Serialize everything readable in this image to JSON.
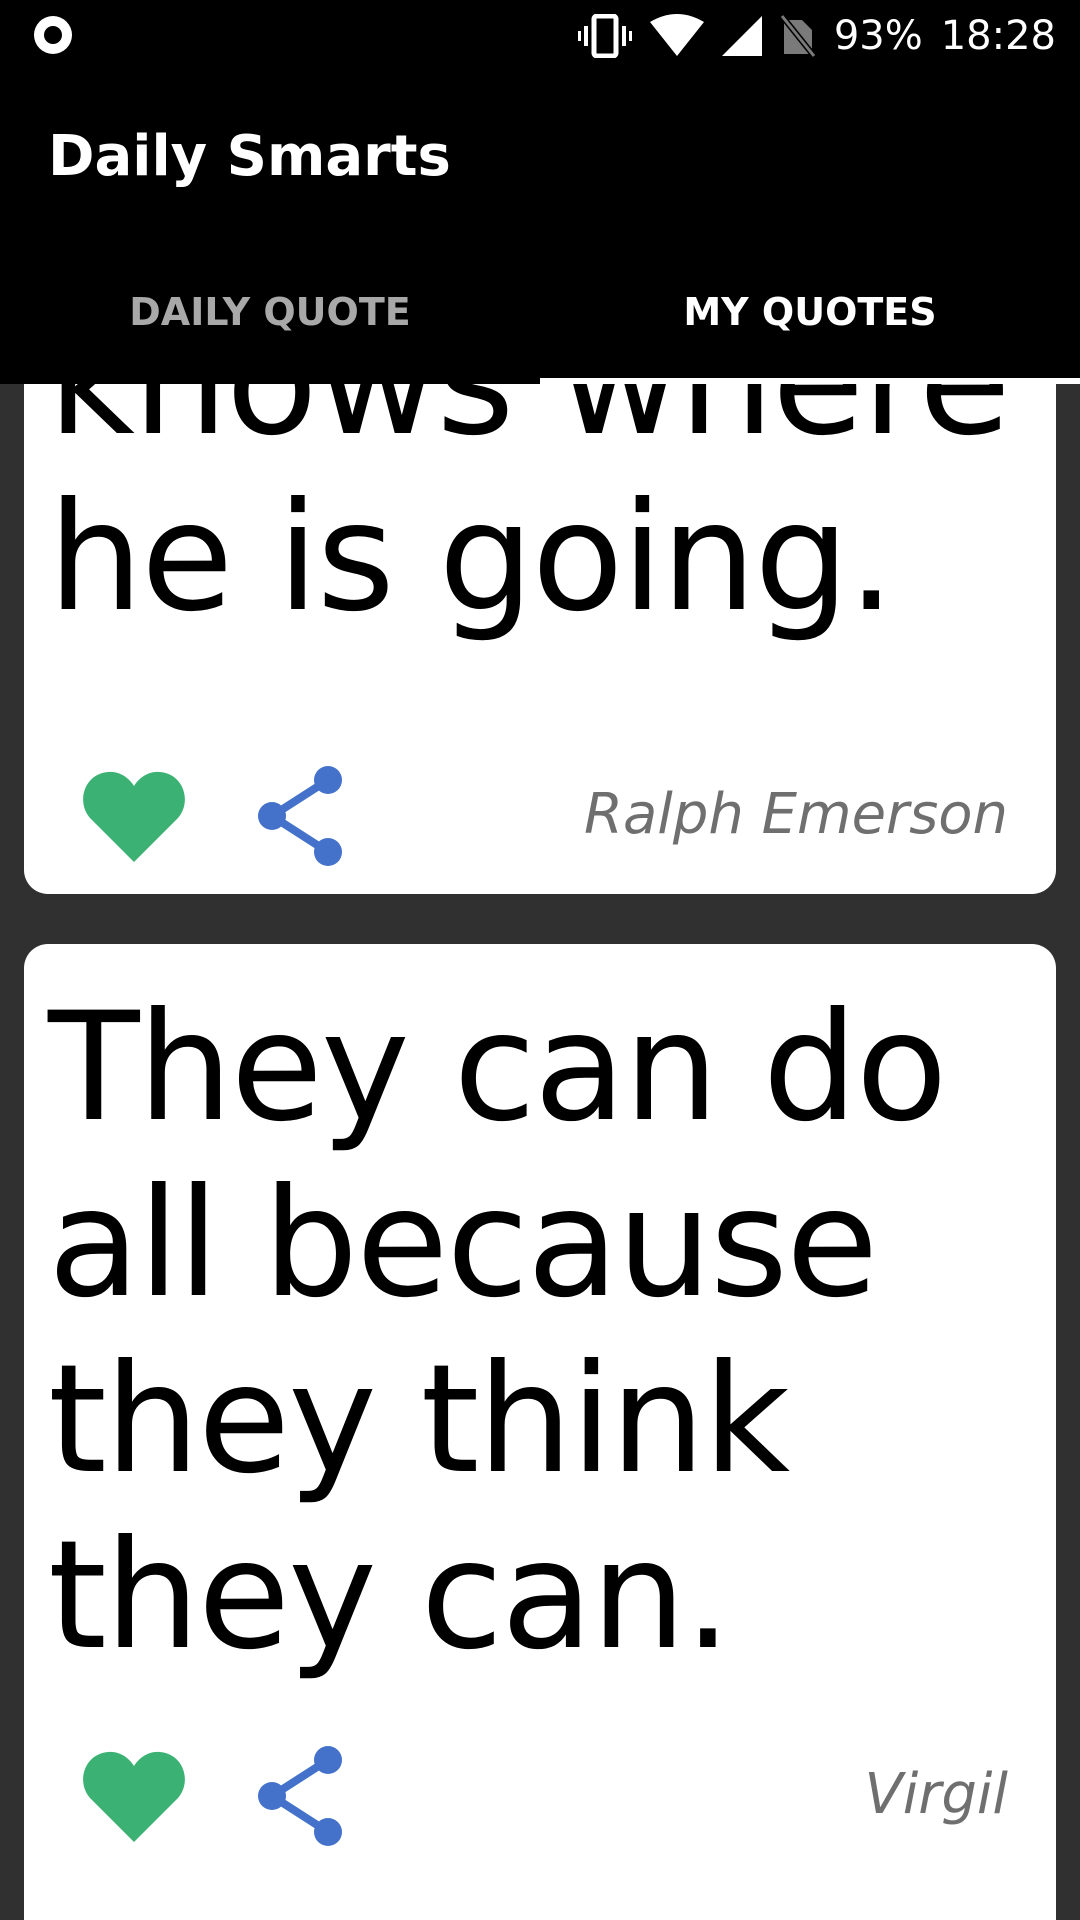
{
  "status_bar": {
    "battery_percent": "93%",
    "time": "18:28"
  },
  "app_bar": {
    "title": "Daily Smarts"
  },
  "tabs": [
    {
      "label": "DAILY QUOTE",
      "selected": false
    },
    {
      "label": "MY QUOTES",
      "selected": true
    }
  ],
  "quotes": [
    {
      "text": "knows where he is going.",
      "author": "Ralph Emerson",
      "favorited": true
    },
    {
      "text": "They can do all because they think they can.",
      "author": "Virgil",
      "favorited": true
    }
  ],
  "colors": {
    "heart": "#3bb273",
    "share": "#4472ca",
    "background": "#303030",
    "app_bar": "#000000"
  },
  "icons": {
    "record": "record-indicator-icon",
    "vibrate": "vibrate-icon",
    "wifi": "wifi-icon",
    "signal": "signal-icon",
    "no_sim": "no-sim-icon",
    "favorite": "heart-icon",
    "share": "share-icon"
  }
}
